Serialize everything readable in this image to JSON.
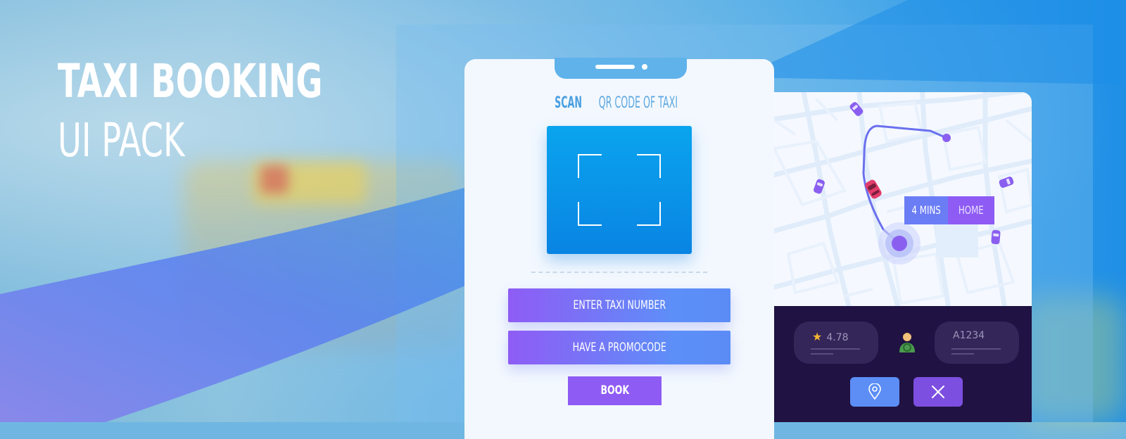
{
  "hero": {
    "title_line1": "TAXI BOOKING",
    "title_line2": "UI PACK"
  },
  "scan_screen": {
    "title_bold": "SCAN",
    "title_rest": " QR CODE OF TAXI",
    "enter_taxi_label": "ENTER TAXI NUMBER",
    "promo_label": "HAVE A PROMOCODE",
    "book_label": "BOOK"
  },
  "map_screen": {
    "eta_time": "4 MINS",
    "eta_destination": "HOME",
    "rating": "4.78",
    "plate": "A1234"
  },
  "colors": {
    "accent_purple": "#8e5bf4",
    "accent_blue": "#5d8ff8",
    "qr_blue": "#0984e3",
    "dark_panel": "#201242",
    "route": "#6b70ee",
    "taxi_red": "#e23c6b"
  },
  "icons": {
    "location": "location-pin-icon",
    "close": "close-icon",
    "star": "star-icon",
    "driver": "driver-icon",
    "car": "car-icon"
  }
}
